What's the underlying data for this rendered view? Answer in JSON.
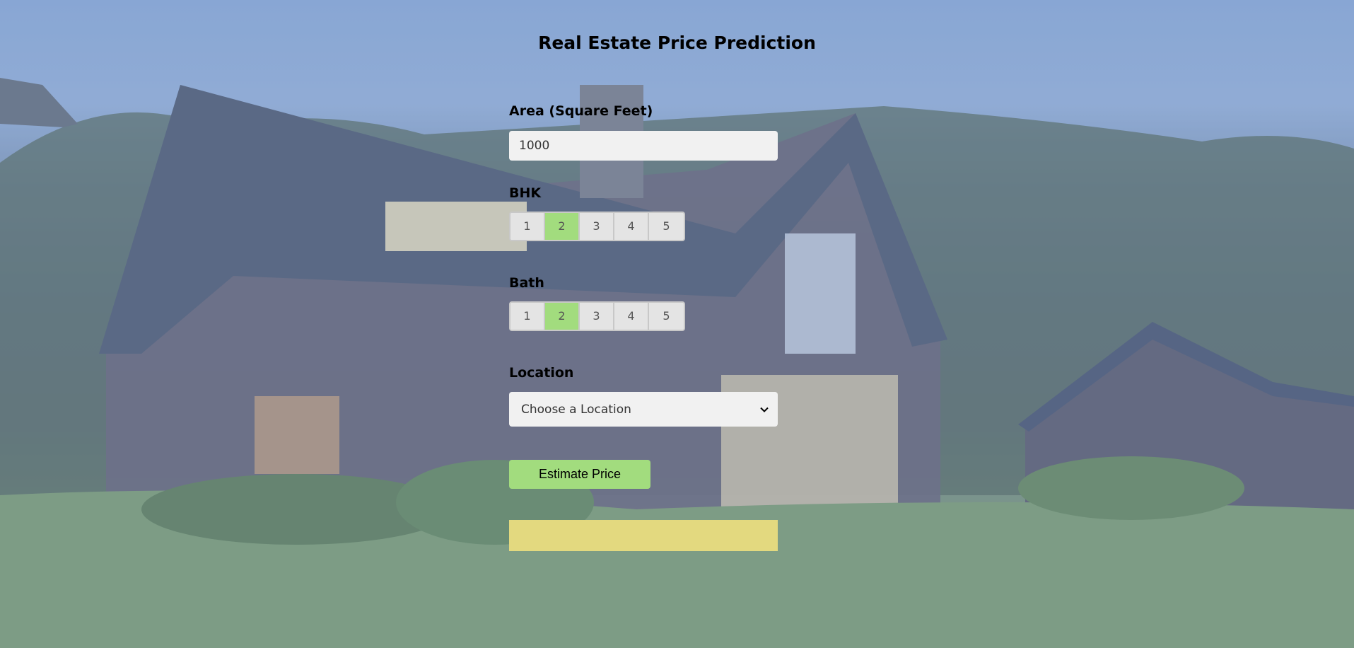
{
  "page": {
    "title": "Real Estate Price Prediction"
  },
  "form": {
    "area": {
      "label": "Area (Square Feet)",
      "value": "1000"
    },
    "bhk": {
      "label": "BHK",
      "options": [
        "1",
        "2",
        "3",
        "4",
        "5"
      ],
      "selected": "2"
    },
    "bath": {
      "label": "Bath",
      "options": [
        "1",
        "2",
        "3",
        "4",
        "5"
      ],
      "selected": "2"
    },
    "location": {
      "label": "Location",
      "selected_text": "Choose a Location"
    },
    "estimate_button_label": "Estimate Price",
    "result_text": ""
  },
  "colors": {
    "accent_green": "#a2dc7e",
    "result_yellow": "#e3d97f",
    "input_bg": "#f1f1f1"
  },
  "icons": {
    "location_dropdown": "chevron-down-icon"
  }
}
